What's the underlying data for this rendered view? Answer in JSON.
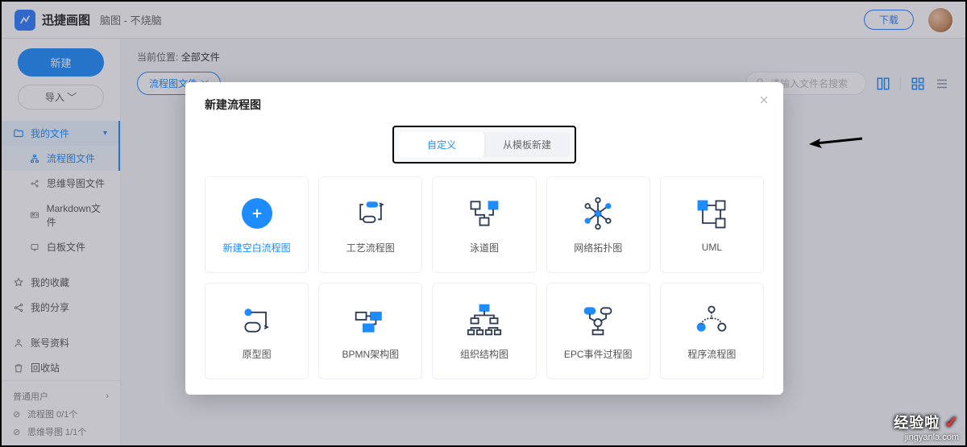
{
  "topbar": {
    "app_name": "迅捷画图",
    "doc_title": "脑图 - 不烧脑",
    "download": "下载"
  },
  "sidebar": {
    "new_btn": "新建",
    "import_btn": "导入 ﹀",
    "my_files": "我的文件",
    "items": [
      "流程图文件",
      "思维导图文件",
      "Markdown文件",
      "白板文件"
    ],
    "favorites": "我的收藏",
    "shares": "我的分享",
    "account": "账号资料",
    "recycle": "回收站",
    "user_type": "普通用户",
    "quota1": "流程图 0/1个",
    "quota2": "思维导图 1/1个"
  },
  "main": {
    "crumb_label": "当前位置:",
    "crumb_value": "全部文件",
    "filter_chip": "流程图文件",
    "search_placeholder": "请输入文件名搜索"
  },
  "modal": {
    "title": "新建流程图",
    "tab_custom": "自定义",
    "tab_template": "从模板新建",
    "cards": [
      {
        "label": "新建空白流程图"
      },
      {
        "label": "工艺流程图"
      },
      {
        "label": "泳道图"
      },
      {
        "label": "网络拓扑图"
      },
      {
        "label": "UML"
      },
      {
        "label": "原型图"
      },
      {
        "label": "BPMN架构图"
      },
      {
        "label": "组织结构图"
      },
      {
        "label": "EPC事件过程图"
      },
      {
        "label": "程序流程图"
      }
    ]
  },
  "watermark": {
    "brand": "经验啦",
    "chk": "✓",
    "url": "jingyanla.com"
  }
}
